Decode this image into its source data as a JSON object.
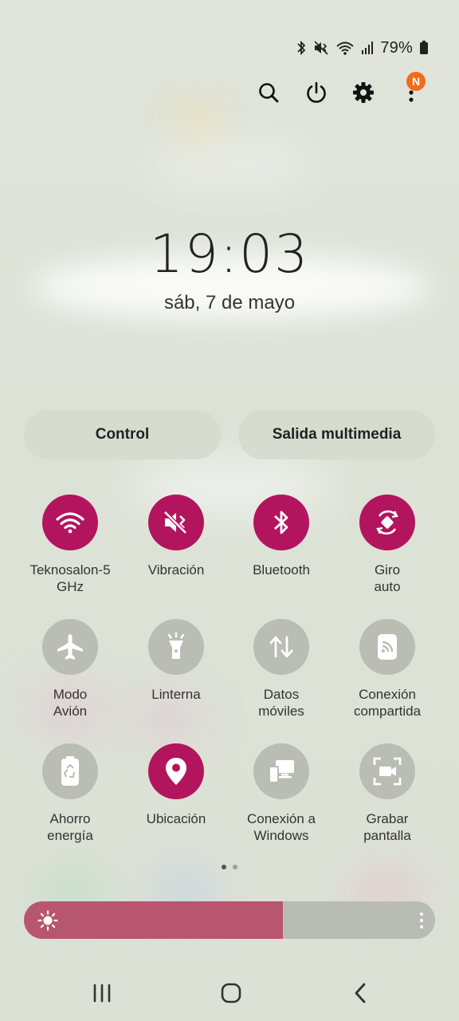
{
  "status_bar": {
    "battery_percent": "79%",
    "icons": [
      "bluetooth-icon",
      "vibrate-icon",
      "wifi-icon",
      "signal-icon",
      "battery-icon"
    ]
  },
  "header": {
    "icons": [
      "search-icon",
      "power-icon",
      "settings-icon",
      "more-icon"
    ],
    "notification_badge": "N"
  },
  "lock_clock": {
    "time": "19:03",
    "date": "sáb, 7 de mayo"
  },
  "panels": {
    "control_label": "Control",
    "media_label": "Salida multimedia"
  },
  "quick_settings": {
    "tiles": [
      {
        "label": "Teknosalon-5\nGHz",
        "icon": "wifi-icon",
        "active": true
      },
      {
        "label": "Vibración",
        "icon": "vibrate-icon",
        "active": true
      },
      {
        "label": "Bluetooth",
        "icon": "bluetooth-icon",
        "active": true
      },
      {
        "label": "Giro\nauto",
        "icon": "auto-rotate-icon",
        "active": true
      },
      {
        "label": "Modo\nAvión",
        "icon": "airplane-icon",
        "active": false
      },
      {
        "label": "Linterna",
        "icon": "flashlight-icon",
        "active": false
      },
      {
        "label": "Datos\nmóviles",
        "icon": "mobile-data-icon",
        "active": false
      },
      {
        "label": "Conexión\ncompartida",
        "icon": "hotspot-icon",
        "active": false
      },
      {
        "label": "Ahorro\nenergía",
        "icon": "battery-saver-icon",
        "active": false
      },
      {
        "label": "Ubicación",
        "icon": "location-icon",
        "active": true
      },
      {
        "label": "Conexión a\nWindows",
        "icon": "link-to-windows-icon",
        "active": false
      },
      {
        "label": "Grabar\npantalla",
        "icon": "screen-record-icon",
        "active": false
      }
    ]
  },
  "pager": {
    "pages": 2,
    "current": 1
  },
  "brightness": {
    "level": 0.63,
    "icon": "sun-icon"
  },
  "nav_bar": {
    "icons": [
      "recents-icon",
      "home-icon",
      "back-icon"
    ]
  },
  "colors": {
    "accent": "#b3145e",
    "inactive_tile": "#b9bdb4",
    "brightness_fill": "#b8566f",
    "badge": "#f26b1d"
  }
}
